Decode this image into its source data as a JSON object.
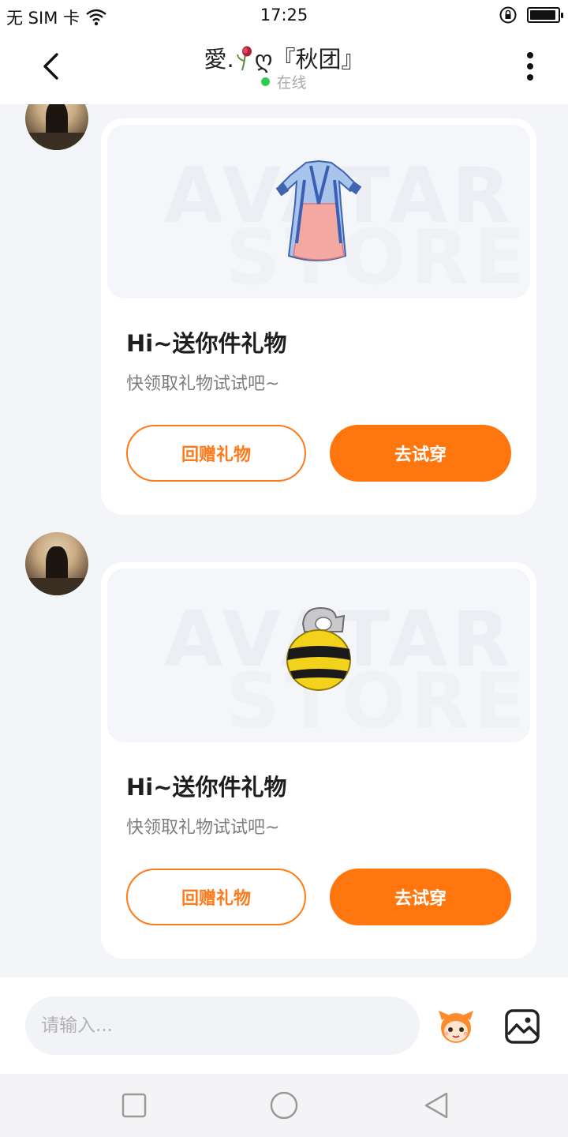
{
  "status_bar": {
    "carrier": "无 SIM 卡",
    "time": "17:25",
    "icons": [
      "wifi-icon",
      "rotation-lock-icon",
      "battery-icon"
    ],
    "battery_level": 0.95
  },
  "header": {
    "title_prefix": "愛.",
    "title_suffix": "ღ『秋团』",
    "presence": "在线",
    "presence_color": "#2ecc52",
    "icons": [
      "back-icon",
      "rose-icon",
      "more-icon"
    ]
  },
  "messages": [
    {
      "gift_icon": "hanfu-dress-icon",
      "watermark_line1": "AVATAR",
      "watermark_line2": "STORE",
      "title": "Hi~送你件礼物",
      "subtitle": "快领取礼物试试吧~",
      "return_gift_label": "回赠礼物",
      "try_on_label": "去试穿"
    },
    {
      "gift_icon": "bee-costume-icon",
      "watermark_line1": "AVATAR",
      "watermark_line2": "STORE",
      "title": "Hi~送你件礼物",
      "subtitle": "快领取礼物试试吧~",
      "return_gift_label": "回赠礼物",
      "try_on_label": "去试穿"
    }
  ],
  "input_bar": {
    "placeholder": "请输入...",
    "icons": [
      "sticker-icon",
      "image-icon"
    ]
  },
  "nav_bar": {
    "icons": [
      "recent-apps-icon",
      "home-icon",
      "back-triangle-icon"
    ]
  },
  "colors": {
    "accent": "#ff760e",
    "background": "#f4f5f8",
    "card": "#ffffff"
  }
}
